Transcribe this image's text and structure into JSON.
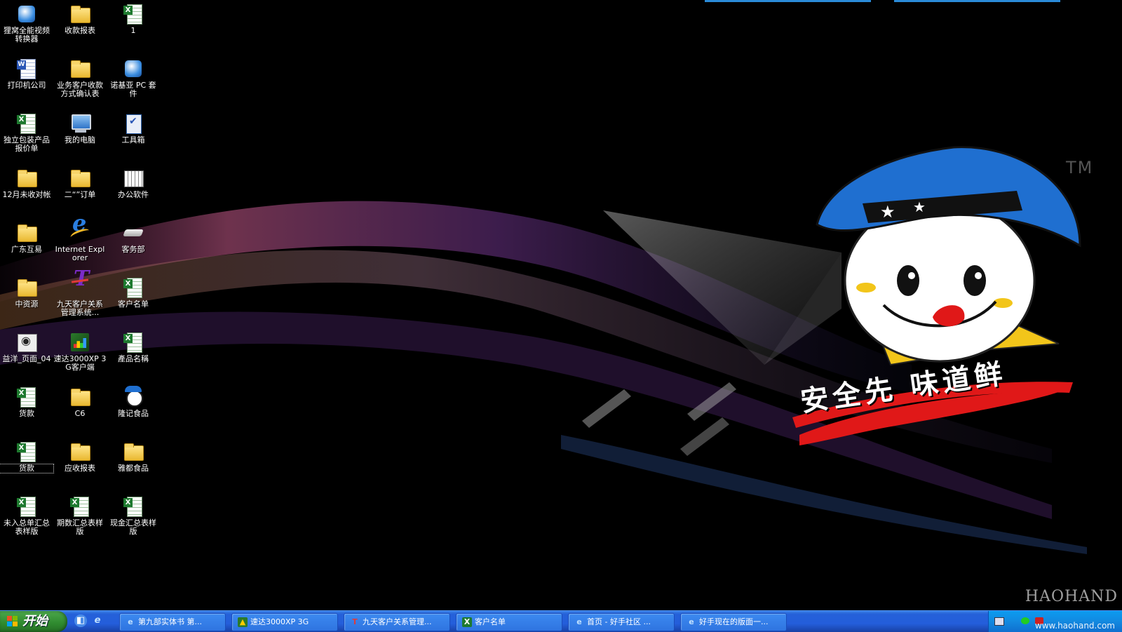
{
  "desktop": {
    "icons": [
      {
        "label": "狸窝全能视频转换器",
        "icon": "video-converter-icon"
      },
      {
        "label": "收款报表",
        "icon": "folder-icon"
      },
      {
        "label": "1",
        "icon": "excel-file-icon"
      },
      {
        "label": "打印机公司",
        "icon": "word-file-icon"
      },
      {
        "label": "业务客户收款方式确认表",
        "icon": "folder-icon"
      },
      {
        "label": "诺基亚 PC 套件",
        "icon": "nokia-pc-suite-icon"
      },
      {
        "label": "独立包装产品报价单",
        "icon": "excel-file-icon"
      },
      {
        "label": "我的电脑",
        "icon": "my-computer-icon"
      },
      {
        "label": "工具箱",
        "icon": "toolbox-icon"
      },
      {
        "label": "12月未收对帐",
        "icon": "folder-icon"
      },
      {
        "label": "二“”订单",
        "icon": "folder-icon"
      },
      {
        "label": "办公软件",
        "icon": "calendar-app-icon"
      },
      {
        "label": "广东互易",
        "icon": "folder-icon"
      },
      {
        "label": "Internet Explorer",
        "icon": "internet-explorer-icon"
      },
      {
        "label": "客务部",
        "icon": "network-drive-icon"
      },
      {
        "label": "中资源",
        "icon": "folder-icon"
      },
      {
        "label": "九天客户关系管理系统...",
        "icon": "crm-app-icon"
      },
      {
        "label": "客户名单",
        "icon": "excel-file-icon"
      },
      {
        "label": "益洋_页面_04",
        "icon": "image-viewer-icon"
      },
      {
        "label": "速达3000XP 3G客户端",
        "icon": "accounting-app-icon"
      },
      {
        "label": "產品名稱",
        "icon": "excel-file-icon"
      },
      {
        "label": "货款",
        "icon": "excel-file-icon"
      },
      {
        "label": "C6",
        "icon": "folder-icon"
      },
      {
        "label": "隆记食品",
        "icon": "mascot-app-icon"
      },
      {
        "label": "货款",
        "icon": "excel-file-icon"
      },
      {
        "label": "应收报表",
        "icon": "folder-icon"
      },
      {
        "label": "雅都食品",
        "icon": "folder-icon"
      },
      {
        "label": "未入总单汇总表样版",
        "icon": "excel-file-icon"
      },
      {
        "label": "期数汇总表样版",
        "icon": "excel-file-icon"
      },
      {
        "label": "现金汇总表样版",
        "icon": "excel-file-icon"
      }
    ],
    "selected_icon_index": 24
  },
  "wallpaper": {
    "trademark": "TM",
    "slogan": "安全先 味道鲜",
    "colors": {
      "hat": "#1f6fd0",
      "scarf": "#f2c51a",
      "brush_stroke": "#e01818",
      "background": "#000000"
    }
  },
  "taskbar": {
    "start_label": "开始",
    "quick_launch": [
      {
        "name": "show-desktop",
        "icon": "show-desktop-icon"
      },
      {
        "name": "internet-explorer",
        "icon": "internet-explorer-icon"
      }
    ],
    "tasks": [
      {
        "label": "第九部实体书 第...",
        "icon": "internet-explorer-icon"
      },
      {
        "label": "速达3000XP 3G",
        "icon": "accounting-app-icon"
      },
      {
        "label": "九天客户关系管理...",
        "icon": "crm-app-icon"
      },
      {
        "label": "客户名单",
        "icon": "excel-file-icon"
      },
      {
        "label": "首页 - 好手社区 ...",
        "icon": "internet-explorer-icon"
      },
      {
        "label": "好手现在的版面一...",
        "icon": "internet-explorer-icon"
      }
    ],
    "colors": {
      "taskbar": "#245edb",
      "start": "#2f8a2f",
      "tray": "#0f8ae3"
    }
  },
  "watermark": {
    "brand": "HAOHAND",
    "url": "www.haohand.com"
  }
}
